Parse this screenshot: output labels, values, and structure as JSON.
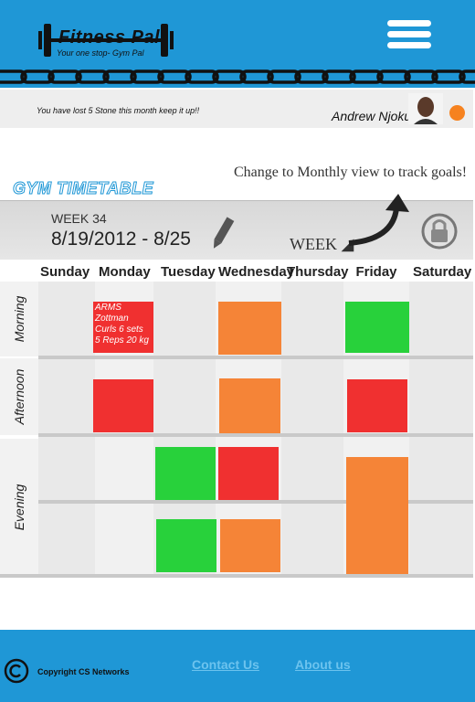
{
  "header": {
    "brand": "Fitness Pal",
    "tagline": "Your one stop- Gym Pal"
  },
  "notice": {
    "message": "You have lost 5 Stone this month keep it up!!",
    "user_name": "Andrew Njoku",
    "status_color": "#f6821f"
  },
  "timetable": {
    "section_title": "GYM TIMETABLE",
    "hint": "Change to Monthly view to track goals!",
    "week_label": "WEEK 34",
    "date_range": "8/19/2012 - 8/25",
    "view_toggle": "WEEK",
    "days": [
      "Sunday",
      "Monday",
      "Tuesday",
      "Wednesday",
      "Thursday",
      "Friday",
      "Saturday"
    ],
    "periods": [
      "Morning",
      "Afternoon",
      "Evening"
    ],
    "sessions": [
      {
        "day": "Monday",
        "period": "Morning",
        "lines": [
          "ARMS",
          "Zottman",
          "Curls 6 sets",
          "5 Reps 20 kg"
        ]
      }
    ]
  },
  "footer": {
    "copyright": "Copyright CS Networks",
    "links": [
      "Contact Us",
      "About us"
    ]
  },
  "colors": {
    "brand_blue": "#1f97d6",
    "session_red": "#f03030",
    "session_orange": "#f58437",
    "session_green": "#28d13b"
  },
  "icons": [
    "dumbbell-icon",
    "hamburger-menu-icon",
    "chain-icon",
    "pencil-icon",
    "curved-arrow-icon",
    "lock-refresh-icon",
    "copyright-icon"
  ]
}
